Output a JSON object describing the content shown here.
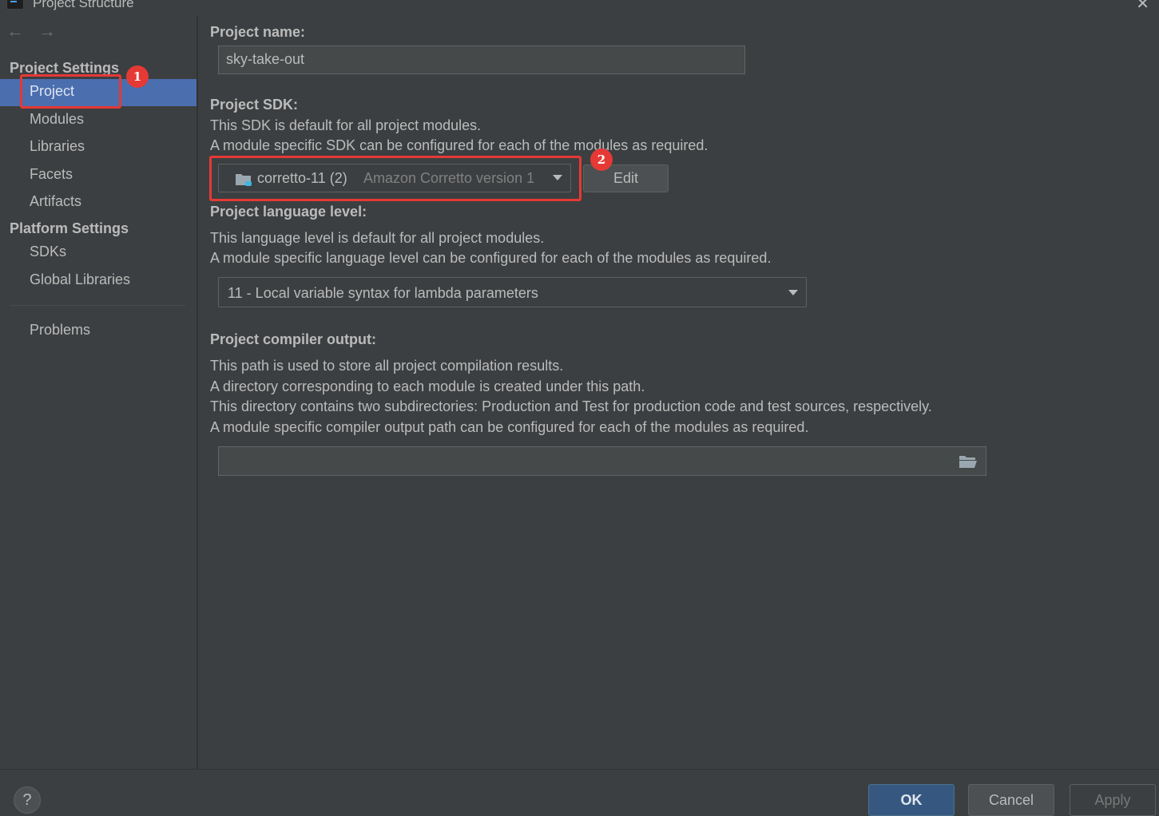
{
  "window": {
    "title": "Project Structure"
  },
  "sidebar": {
    "back_arrow": "←",
    "forward_arrow": "→",
    "project_settings_title": "Project Settings",
    "project_items": [
      {
        "label": "Project",
        "selected": true
      },
      {
        "label": "Modules"
      },
      {
        "label": "Libraries"
      },
      {
        "label": "Facets"
      },
      {
        "label": "Artifacts"
      }
    ],
    "platform_settings_title": "Platform Settings",
    "platform_items": [
      {
        "label": "SDKs"
      },
      {
        "label": "Global Libraries"
      }
    ],
    "problems_label": "Problems"
  },
  "main": {
    "project_name": {
      "label": "Project name:",
      "value": "sky-take-out"
    },
    "project_sdk": {
      "label": "Project SDK:",
      "desc1": "This SDK is default for all project modules.",
      "desc2": "A module specific SDK can be configured for each of the modules as required.",
      "selected_name": "corretto-11 (2)",
      "selected_detail": "Amazon Corretto version 1",
      "edit_label": "Edit"
    },
    "language_level": {
      "label": "Project language level:",
      "desc1": "This language level is default for all project modules.",
      "desc2": "A module specific language level can be configured for each of the modules as required.",
      "selected": "11 - Local variable syntax for lambda parameters"
    },
    "compiler_output": {
      "label": "Project compiler output:",
      "desc1": "This path is used to store all project compilation results.",
      "desc2": "A directory corresponding to each module is created under this path.",
      "desc3": "This directory contains two subdirectories: Production and Test for production code and test sources, respectively.",
      "desc4": "A module specific compiler output path can be configured for each of the modules as required.",
      "value": ""
    }
  },
  "annotations": {
    "badge1": "1",
    "badge2": "2",
    "color": "#e53935"
  },
  "footer": {
    "help": "?",
    "ok": "OK",
    "cancel": "Cancel",
    "apply": "Apply"
  },
  "colors": {
    "background": "#3c3f41",
    "selection": "#4b6eaf",
    "ok_button": "#365880",
    "text": "#bbbbbb"
  }
}
